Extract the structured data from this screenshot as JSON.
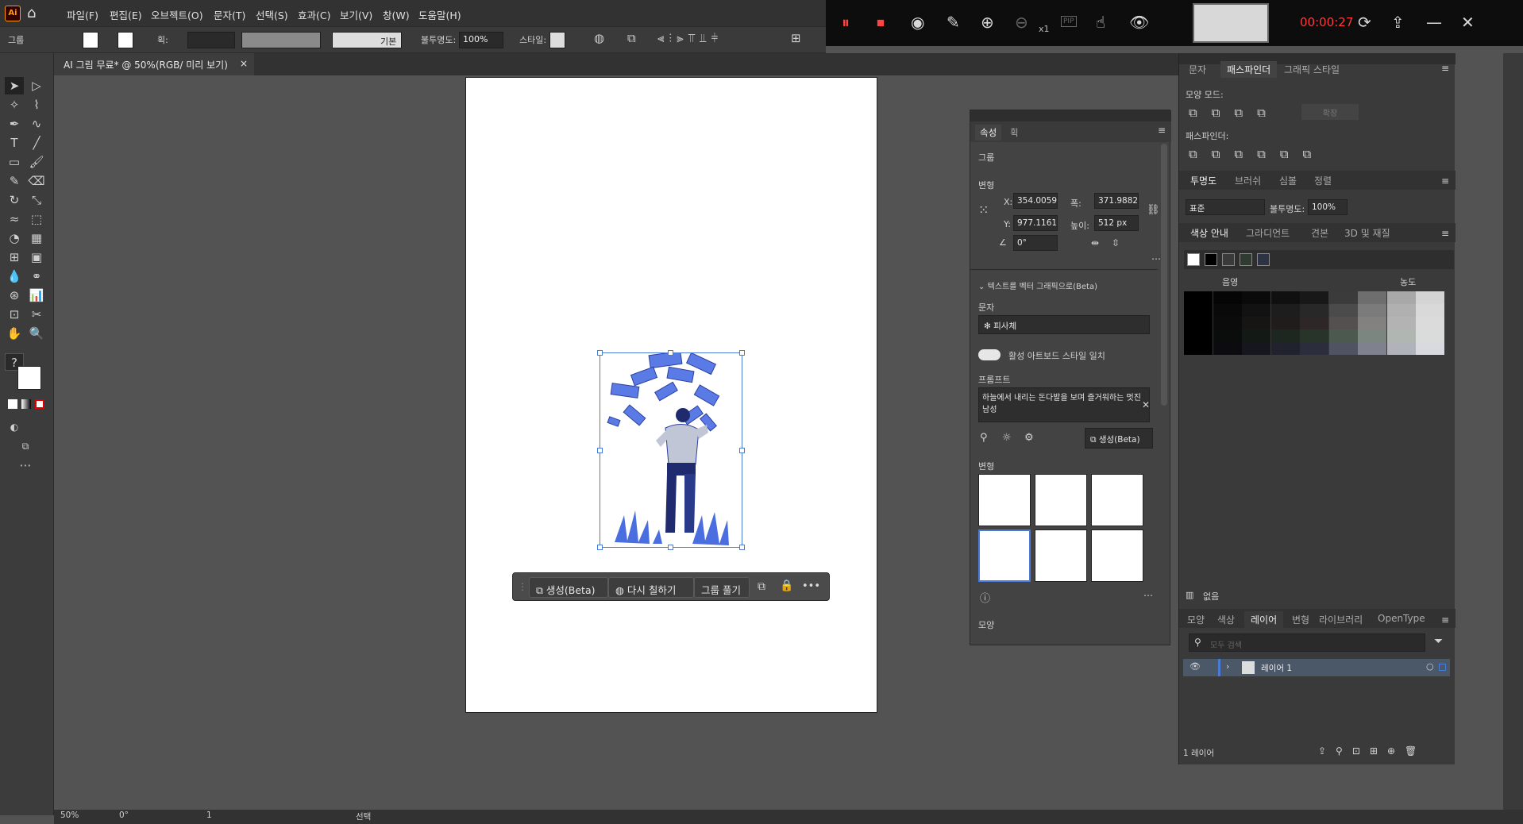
{
  "app": {
    "logo": "Ai",
    "menu": [
      "파일(F)",
      "편집(E)",
      "오브젝트(O)",
      "문자(T)",
      "선택(S)",
      "효과(C)",
      "보기(V)",
      "창(W)",
      "도움말(H)"
    ]
  },
  "recorder": {
    "timer": "00:00:27",
    "zoom_label": "x1",
    "pip_label": "PIP"
  },
  "control_bar": {
    "label": "그룹",
    "stroke_label": "획:",
    "stroke_style": "기본",
    "opacity_label": "불투명도:",
    "opacity_value": "100%",
    "style_label": "스타일:"
  },
  "document_tab": {
    "title": "AI 그림 무료* @ 50%(RGB/ 미리 보기)",
    "close": "×"
  },
  "context_bar": {
    "generate": "생성(Beta)",
    "recolor": "다시 칠하기",
    "ungroup": "그룹 풀기",
    "more": "•••"
  },
  "properties": {
    "tabs": [
      "속성",
      "획"
    ],
    "group_label": "그룹",
    "transform_label": "변형",
    "x_label": "X:",
    "x_value": "354.0059",
    "y_label": "Y:",
    "y_value": "977.1161",
    "w_label": "폭:",
    "w_value": "371.9882",
    "h_label": "높이:",
    "h_value": "512 px",
    "angle_value": "0°",
    "text_to_vector": "텍스트를 벡터 그래픽으로(Beta)",
    "type_label": "문자",
    "type_value": "피사체",
    "match_style": "활성 아트보드 스타일 일치",
    "prompt_label": "프롬프트",
    "prompt_value": "하늘에서 내리는 돈다발을 보며 즐거워하는 멋진 남성",
    "generate_button": "생성(Beta)",
    "variations_label": "변형",
    "appearance_label": "모양"
  },
  "pathfinder": {
    "tabs": [
      "문자",
      "패스파인더",
      "그래픽 스타일"
    ],
    "shape_modes": "모양 모드:",
    "expand": "확장",
    "pathfinders": "패스파인더:"
  },
  "transparency": {
    "tabs": [
      "투명도",
      "브러쉬",
      "심볼",
      "정렬"
    ],
    "blend_mode": "표준",
    "opacity_label": "불투명도:",
    "opacity_value": "100%"
  },
  "color_guide": {
    "tabs": [
      "색상 안내",
      "그라디언트",
      "견본",
      "3D 및 재질"
    ],
    "shade_label": "음영",
    "tint_label": "농도",
    "none_label": "없음",
    "base_colors": [
      "#ffffff",
      "#000000",
      "#3a3a3a",
      "#2f3a31",
      "#2d3244"
    ],
    "grid_colors": [
      [
        "#000000",
        "#050505",
        "#0a0a0a",
        "#101010",
        "#181818",
        "#3b3b3b",
        "#6e6e6e",
        "#a8a8a8",
        "#d4d4d4"
      ],
      [
        "#000000",
        "#090909",
        "#121212",
        "#1d1d1d",
        "#282828",
        "#4b4b4b",
        "#7b7b7b",
        "#b0b0b0",
        "#d9d9d9"
      ],
      [
        "#000000",
        "#0b0b0b",
        "#171414",
        "#211c1c",
        "#2e2727",
        "#545050",
        "#838080",
        "#b4b3b3",
        "#dbdbdb"
      ],
      [
        "#000000",
        "#0a0d0b",
        "#131a15",
        "#1d261f",
        "#283329",
        "#4b594e",
        "#7c8680",
        "#b0b6b2",
        "#d9dcda"
      ],
      [
        "#000000",
        "#0b0b10",
        "#16171e",
        "#20222d",
        "#2b2d3c",
        "#505362",
        "#7f828e",
        "#b1b3bb",
        "#d9dadf"
      ]
    ]
  },
  "layers": {
    "tabs": [
      "모양",
      "색상",
      "레이어",
      "변형",
      "라이브러리",
      "OpenType"
    ],
    "search_placeholder": "모두 검색",
    "layer_name": "레이어 1",
    "layer_count": "1 레이어"
  },
  "status": {
    "zoom": "50%",
    "rotation": "0°",
    "page": "1",
    "mode": "선택"
  }
}
